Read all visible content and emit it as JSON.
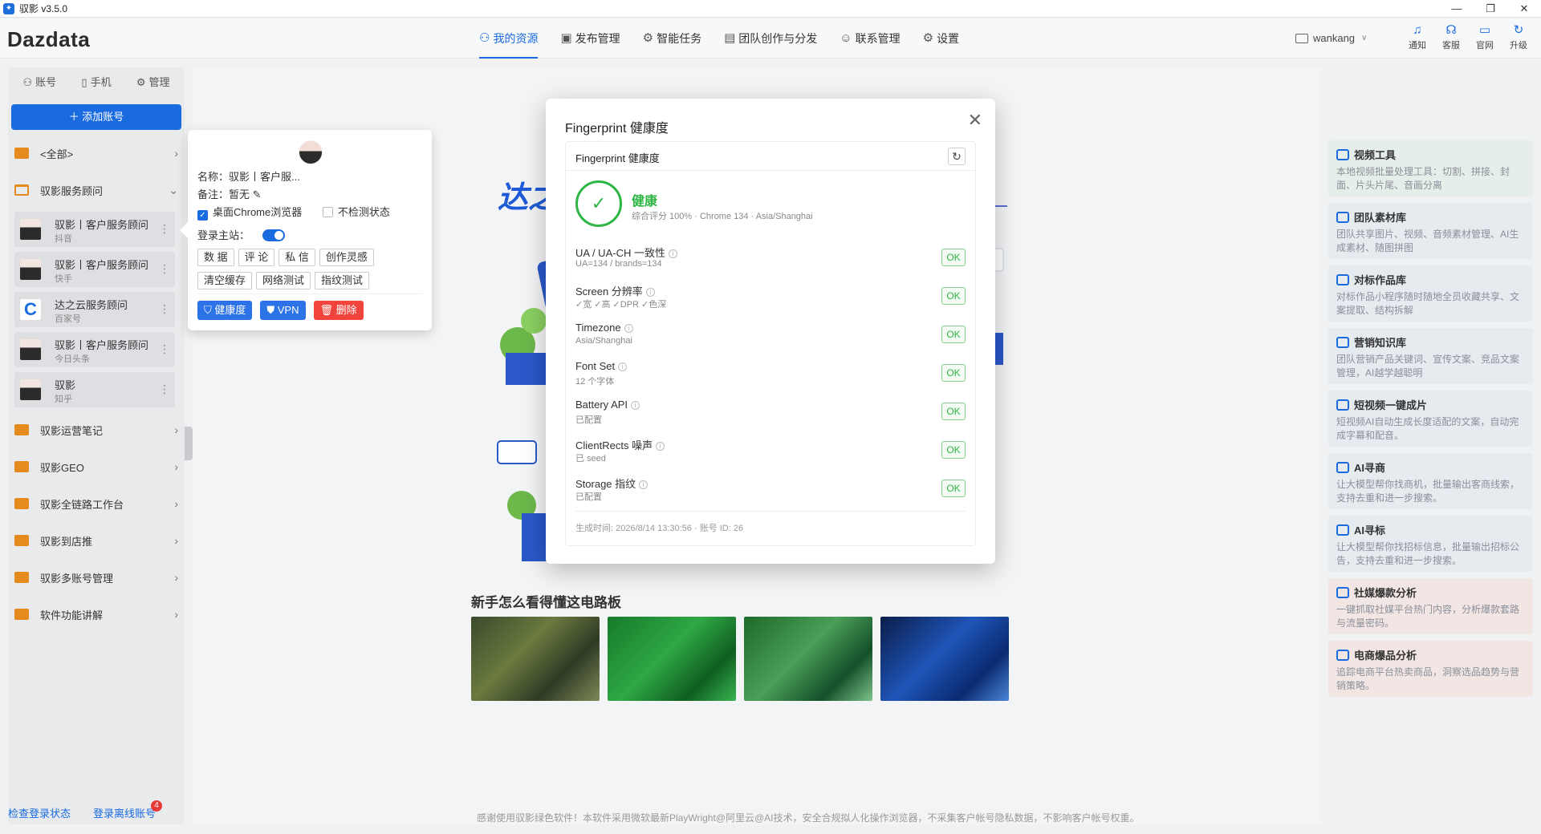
{
  "window": {
    "title": "驭影 v3.5.0",
    "controls": [
      "—",
      "❐",
      "✕"
    ]
  },
  "header": {
    "logo": "Dazdata",
    "nav": [
      {
        "label": "我的资源",
        "icon": "users-icon",
        "active": true
      },
      {
        "label": "发布管理",
        "icon": "publish-icon"
      },
      {
        "label": "智能任务",
        "icon": "task-icon"
      },
      {
        "label": "团队创作与分发",
        "icon": "team-icon"
      },
      {
        "label": "联系管理",
        "icon": "contact-icon"
      },
      {
        "label": "设置",
        "icon": "gear-icon"
      }
    ],
    "user": "wankang",
    "tools": [
      {
        "label": "通知",
        "icon": "bell-icon"
      },
      {
        "label": "客服",
        "icon": "headset-icon"
      },
      {
        "label": "官网",
        "icon": "monitor-icon"
      },
      {
        "label": "升级",
        "icon": "refresh-icon"
      }
    ]
  },
  "sidebar": {
    "tabs": [
      "账号",
      "手机",
      "管理"
    ],
    "add_button": "＋ 添加账号",
    "all": "<全部>",
    "open_folder": "驭影服务顾问",
    "accounts": [
      {
        "name": "驭影丨客户服务顾问",
        "platform": "抖音"
      },
      {
        "name": "驭影丨客户服务顾问",
        "platform": "快手"
      },
      {
        "name": "达之云服务顾问",
        "platform": "百家号"
      },
      {
        "name": "驭影丨客户服务顾问",
        "platform": "今日头条"
      },
      {
        "name": "驭影",
        "platform": "知乎"
      }
    ],
    "folders": [
      "驭影运营笔记",
      "驭影GEO",
      "驭影全链路工作台",
      "驭影到店推",
      "驭影多账号管理",
      "软件功能讲解"
    ],
    "footer": {
      "check_login": "检查登录状态",
      "offline_login": "登录离线账号",
      "badge": "4"
    }
  },
  "popover": {
    "name": "名称：驭影丨客户服...",
    "note": "备注：暂无",
    "desktop_chrome": "桌面Chrome浏览器",
    "no_check": "不检测状态",
    "login_site": "登录主站：",
    "buttons_row1": [
      "数 据",
      "评 论",
      "私 信",
      "创作灵感"
    ],
    "buttons_row2": [
      "清空缓存",
      "网络测试",
      "指纹测试"
    ],
    "health": "健康度",
    "vpn": "VPN",
    "delete": "删除"
  },
  "main": {
    "hero": "达之",
    "circuit_title": "新手怎么看得懂这电路板",
    "footer": "感谢使用驭影绿色软件！本软件采用微软最新PlayWright@阿里云@AI技术，安全合规拟人化操作浏览器，不采集客户帐号隐私数据，不影响客户帐号权重。"
  },
  "tools": [
    {
      "title": "视频工具",
      "desc": "本地视频批量处理工具：切割、拼接、封面、片头片尾、音画分离",
      "bg": "#e6eee9"
    },
    {
      "title": "团队素材库",
      "desc": "团队共享图片、视频、音频素材管理、AI生成素材、随图拼图",
      "bg": "#e6ebf0"
    },
    {
      "title": "对标作品库",
      "desc": "对标作品小程序随时随地全员收藏共享、文案提取、结构拆解",
      "bg": "#e6ebf0"
    },
    {
      "title": "营销知识库",
      "desc": "团队营销产品关键词、宣传文案、竞品文案管理，AI越学越聪明",
      "bg": "#e6ebf0"
    },
    {
      "title": "短视频一键成片",
      "desc": "短视频AI自动生成长度适配的文案，自动完成字幕和配音。",
      "bg": "#e6ebf0"
    },
    {
      "title": "AI寻商",
      "desc": "让大模型帮你找商机，批量输出客商线索，支持去重和进一步搜索。",
      "bg": "#e6ebf0"
    },
    {
      "title": "AI寻标",
      "desc": "让大模型帮你找招标信息，批量输出招标公告，支持去重和进一步搜索。",
      "bg": "#e6ebf0"
    },
    {
      "title": "社媒爆款分析",
      "desc": "一键抓取社媒平台热门内容，分析爆款套路与流量密码。",
      "bg": "#f1e6e4"
    },
    {
      "title": "电商爆品分析",
      "desc": "追踪电商平台热卖商品，洞察选品趋势与营销策略。",
      "bg": "#f1e6e4"
    }
  ],
  "modal": {
    "title": "Fingerprint 健康度",
    "card_title": "Fingerprint 健康度",
    "status": "健康",
    "summary": "综合评分 100% · Chrome 134 · Asia/Shanghai",
    "checks": [
      {
        "name": "UA / UA-CH 一致性",
        "detail": "UA=134 / brands=134",
        "status": "OK"
      },
      {
        "name": "Screen 分辨率",
        "detail": "✓宽 ✓高 ✓DPR ✓色深",
        "status": "OK"
      },
      {
        "name": "Timezone",
        "detail": "Asia/Shanghai",
        "status": "OK"
      },
      {
        "name": "Font Set",
        "detail": "12 个字体",
        "status": "OK"
      },
      {
        "name": "Battery API",
        "detail": "已配置",
        "status": "OK"
      },
      {
        "name": "ClientRects 噪声",
        "detail": "已 seed",
        "status": "OK"
      },
      {
        "name": "Storage 指纹",
        "detail": "已配置",
        "status": "OK"
      }
    ],
    "footer": "生成时间: 2026/8/14 13:30:56 · 账号 ID: 26"
  }
}
